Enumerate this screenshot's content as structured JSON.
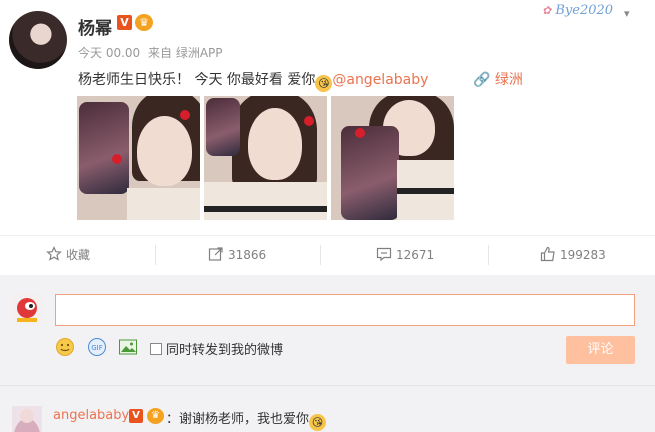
{
  "post": {
    "username": "杨幂",
    "v_badge": "V",
    "time": "今天 00.00",
    "source": "来自 绿洲APP",
    "text_before": "杨老师生日快乐！ 今天 你最好看 爱你",
    "mention": "@angelababy",
    "location": "绿洲",
    "corner_tag": "Bye2020",
    "images": [
      "photo-1",
      "photo-2",
      "photo-3"
    ]
  },
  "actions": {
    "favorite_label": "收藏",
    "repost_count": "31866",
    "comment_count": "12671",
    "like_count": "199283"
  },
  "comment_box": {
    "placeholder": "",
    "repost_label": "同时转发到我的微博",
    "submit_label": "评论"
  },
  "reply": {
    "name": "angelababy",
    "v_badge": "V",
    "text": "：谢谢杨老师，我也爱你"
  },
  "colors": {
    "accent": "#eb7350",
    "submit_bg": "#ffc09f",
    "v_badge": "#e8531e",
    "comment_bg": "#f2f2f5"
  }
}
